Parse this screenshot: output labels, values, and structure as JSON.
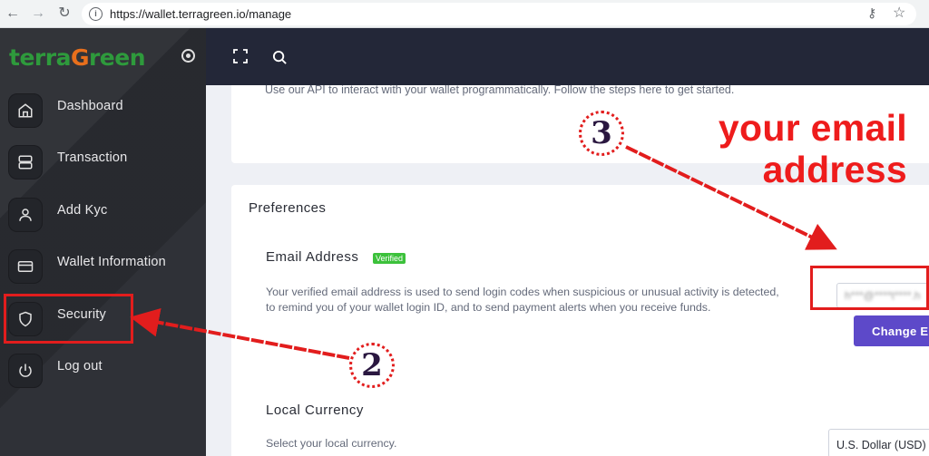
{
  "browser": {
    "url": "https://wallet.terragreen.io/manage",
    "info_glyph": "i",
    "back_glyph": "←",
    "forward_glyph": "→",
    "reload_glyph": "↻",
    "key_glyph": "⚷",
    "star_glyph": "☆"
  },
  "brand": {
    "logo_part1": "terra",
    "logo_o": "G",
    "logo_part2": "reen",
    "green": "#2e9a3c",
    "orange": "#e86f1c"
  },
  "sidebar": {
    "items": [
      {
        "label": "Dashboard",
        "icon": "home-icon"
      },
      {
        "label": "Transaction",
        "icon": "server-icon"
      },
      {
        "label": "Add Kyc",
        "icon": "user-icon"
      },
      {
        "label": "Wallet Information",
        "icon": "credit-card-icon"
      },
      {
        "label": "Security",
        "icon": "shield-icon"
      },
      {
        "label": "Log out",
        "icon": "power-icon"
      }
    ]
  },
  "main": {
    "api_text": "Use our API to interact with your wallet programmatically. Follow the steps here to get started.",
    "preferences_title": "Preferences",
    "email_title": "Email Address",
    "verified_badge": "Verified",
    "email_desc_line1": "Your verified email address is used to send login codes when suspicious or unusual activity is detected,",
    "email_desc_line2": "to remind you of your wallet login ID, and to send payment alerts when you receive funds.",
    "email_value": "h***@****t****.h",
    "change_email_button": "Change Email",
    "currency_title": "Local Currency",
    "currency_desc": "Select your local currency.",
    "currency_value": "U.S. Dollar (USD)"
  },
  "annotations": {
    "your_email_line1": "your email",
    "your_email_line2": "address",
    "step_3": "3",
    "step_2": "2",
    "color": "#e21d1d"
  }
}
